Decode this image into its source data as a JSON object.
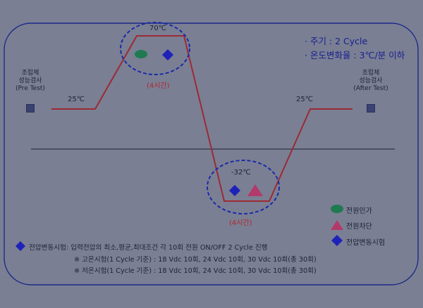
{
  "colors": {
    "background": "#7a7f93",
    "profile_line": "#9c2a35",
    "dashed_ellipse": "#1a2aa8",
    "power_on": "#1f7a52",
    "power_off": "#b23a6a",
    "voltage_test": "#1f22b8"
  },
  "top_note": {
    "line1": "· 주기 : 2 Cycle",
    "line2": "· 온도변화율 : 3℃/분 이하"
  },
  "pre_test": {
    "line1": "조립체",
    "line2": "성능검사",
    "line3": "(Pre Test)"
  },
  "after_test": {
    "line1": "조립체",
    "line2": "성능검사",
    "line3": "(After Test)"
  },
  "profile": {
    "start_temp": "25℃",
    "end_temp": "25℃",
    "high_temp": "70℃",
    "low_temp": "-32℃",
    "high_duration": "(4시간)",
    "low_duration": "(4시간)"
  },
  "legend": {
    "power_on": "전원인가",
    "power_off": "전원차단",
    "voltage_test": "전압변동시험"
  },
  "bottom_notes": {
    "line1": "전압변동시험: 입력전압의 최소,평균,최대조건 각 10회 전원 ON/OFF 2 Cycle 진행",
    "line2": "※ 고온시험(1 Cycle 기준) : 18 Vdc 10회, 24 Vdc 10회, 30 Vdc 10회(총 30회)",
    "line3": "※ 저온시험(1 Cycle 기준) : 18 Vdc 10회, 24 Vdc 10회, 30 Vdc 10회(총 30회)"
  }
}
